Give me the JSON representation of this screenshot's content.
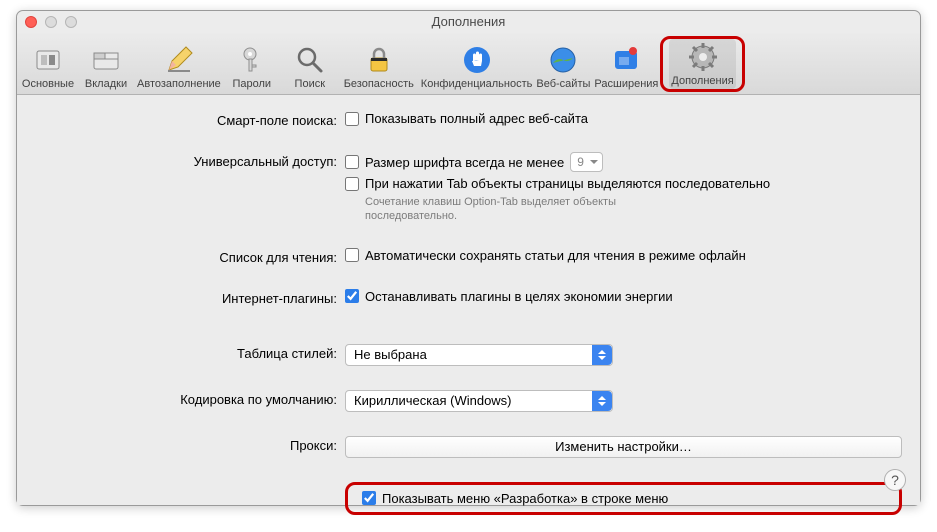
{
  "window": {
    "title": "Дополнения"
  },
  "toolbar": {
    "items": [
      {
        "id": "general",
        "label": "Основные"
      },
      {
        "id": "tabs",
        "label": "Вкладки"
      },
      {
        "id": "autofill",
        "label": "Автозаполнение"
      },
      {
        "id": "passwords",
        "label": "Пароли"
      },
      {
        "id": "search",
        "label": "Поиск"
      },
      {
        "id": "security",
        "label": "Безопасность"
      },
      {
        "id": "privacy",
        "label": "Конфиденциальность"
      },
      {
        "id": "websites",
        "label": "Веб-сайты"
      },
      {
        "id": "extensions",
        "label": "Расширения"
      },
      {
        "id": "advanced",
        "label": "Дополнения"
      }
    ],
    "selected": "advanced"
  },
  "form": {
    "smart_search": {
      "label": "Смарт-поле поиска:",
      "cb_full_address": {
        "label": "Показывать полный адрес веб-сайта",
        "checked": false
      }
    },
    "accessibility": {
      "label": "Универсальный доступ:",
      "cb_min_font": {
        "label": "Размер шрифта всегда не менее",
        "checked": false,
        "value": "9"
      },
      "cb_tab": {
        "label": "При нажатии Tab объекты страницы выделяются последовательно",
        "checked": false
      },
      "hint": "Сочетание клавиш Option-Tab выделяет объекты последовательно."
    },
    "reading_list": {
      "label": "Список для чтения:",
      "cb_save_offline": {
        "label": "Автоматически сохранять статьи для чтения в режиме офлайн",
        "checked": false
      }
    },
    "plugins": {
      "label": "Интернет-плагины:",
      "cb_stop": {
        "label": "Останавливать плагины в целях экономии энергии",
        "checked": true
      }
    },
    "stylesheet": {
      "label": "Таблица стилей:",
      "value": "Не выбрана"
    },
    "encoding": {
      "label": "Кодировка по умолчанию:",
      "value": "Кириллическая (Windows)"
    },
    "proxies": {
      "label": "Прокси:",
      "button": "Изменить настройки…"
    },
    "develop": {
      "cb_show": {
        "label": "Показывать меню «Разработка» в строке меню",
        "checked": true
      }
    }
  },
  "help": "?"
}
